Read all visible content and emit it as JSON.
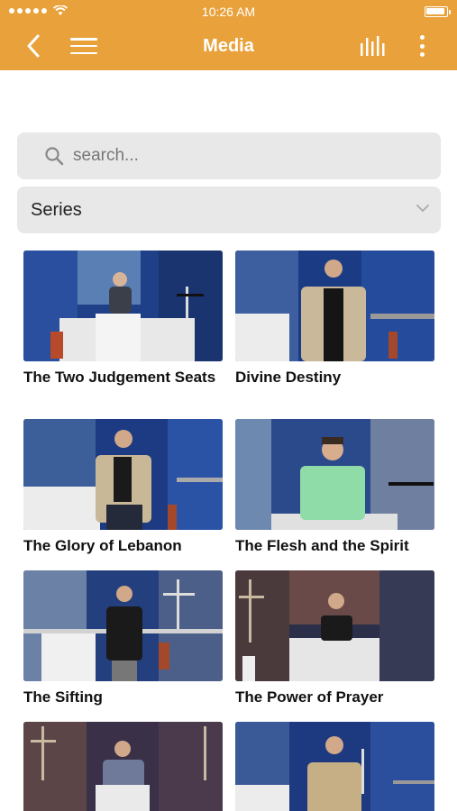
{
  "status": {
    "time": "10:26 AM"
  },
  "nav": {
    "title": "Media"
  },
  "search": {
    "placeholder": "search..."
  },
  "filter": {
    "selected": "Series"
  },
  "items": [
    {
      "title": "The Two Judgement Seats"
    },
    {
      "title": "Divine Destiny"
    },
    {
      "title": "The Glory of Lebanon"
    },
    {
      "title": "The Flesh and the Spirit"
    },
    {
      "title": "The Sifting"
    },
    {
      "title": "The Power of Prayer"
    },
    {
      "title": ""
    },
    {
      "title": ""
    }
  ],
  "colors": {
    "header": "#e9a23b",
    "field": "#e8e8e8"
  }
}
